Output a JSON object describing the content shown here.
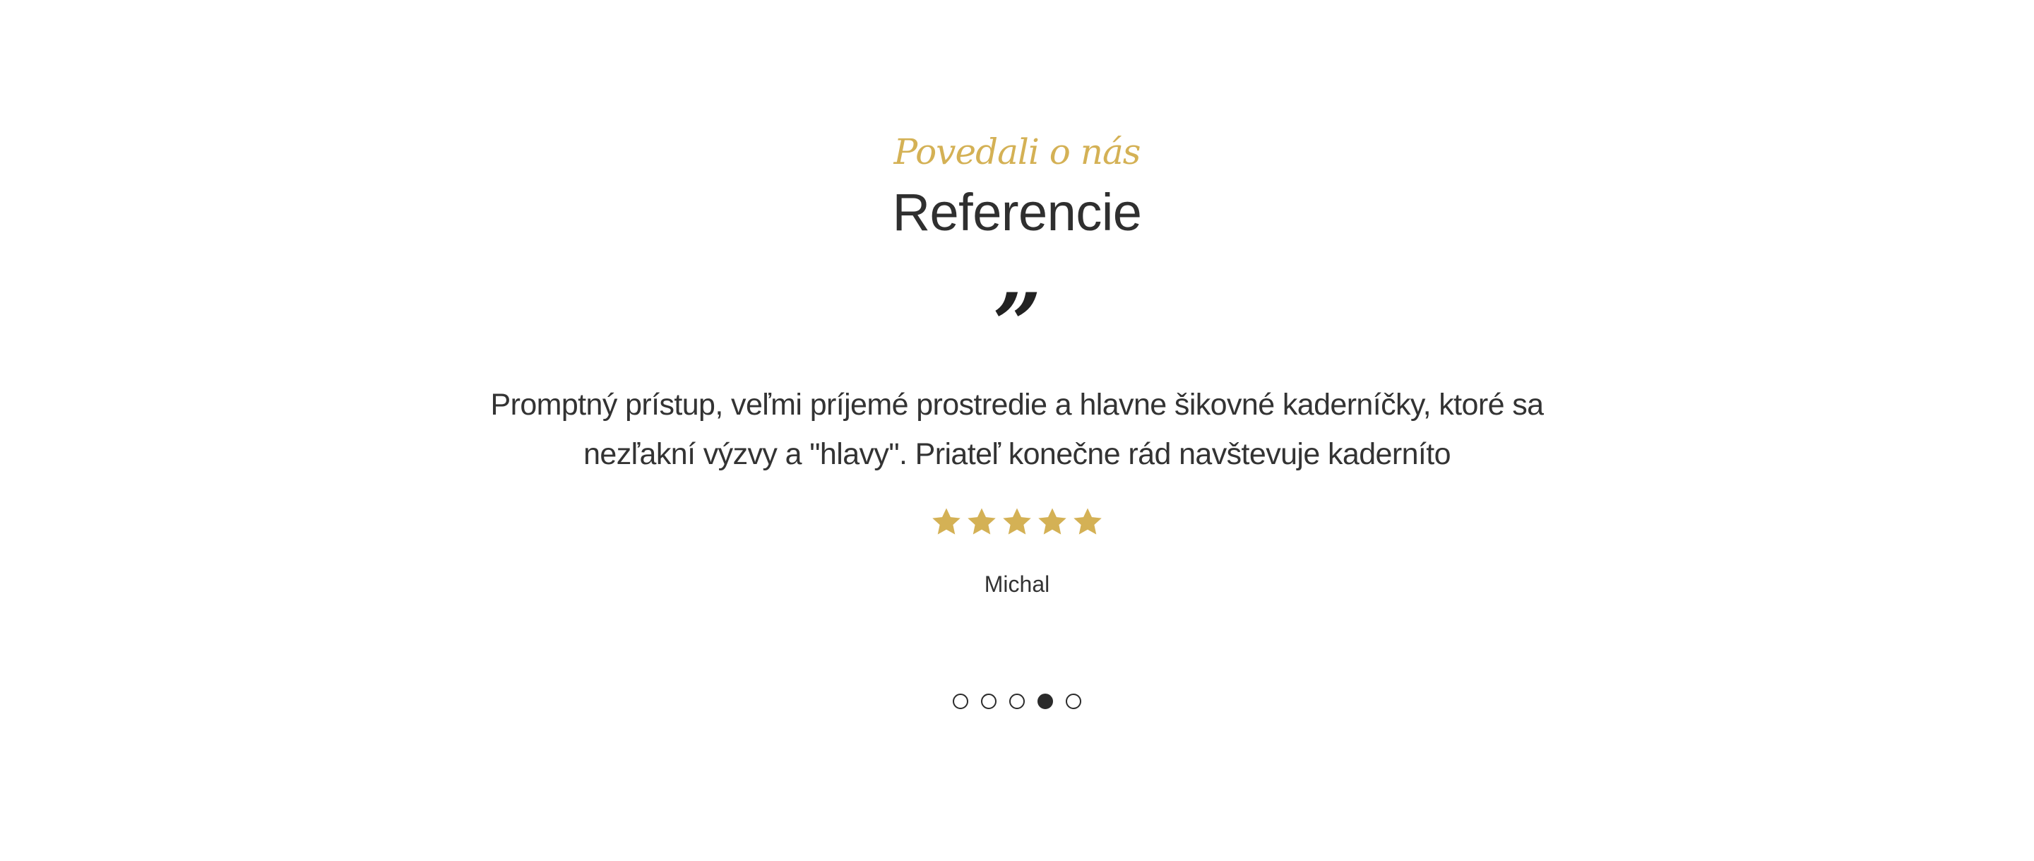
{
  "section": {
    "eyebrow": "Povedali o nás",
    "title": "Referencie"
  },
  "testimonial": {
    "quote_mark": "”",
    "text": "Promptný prístup, veľmi príjemé prostredie a hlavne šikovné kaderníčky, ktoré sa nezľakní výzvy a \"hlavy\". Priateľ konečne rád navštevuje kaderníto",
    "rating": 5,
    "rating_max": 5,
    "author": "Michal"
  },
  "carousel": {
    "slide_count": 5,
    "active_index": 3
  },
  "colors": {
    "accent_gold": "#d4b155",
    "text_dark": "#333333",
    "dot_color": "#2b2b2b"
  },
  "icons": {
    "star": "star-icon",
    "quote": "quote-icon"
  }
}
